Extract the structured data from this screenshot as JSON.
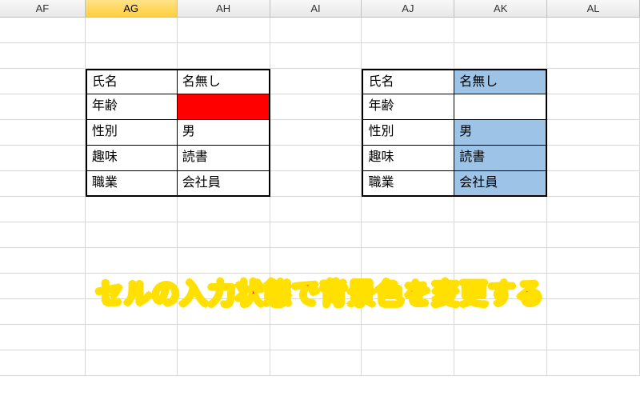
{
  "columns": {
    "AF": "AF",
    "AG": "AG",
    "AH": "AH",
    "AI": "AI",
    "AJ": "AJ",
    "AK": "AK",
    "AL": "AL"
  },
  "activeColumn": "AG",
  "table1": {
    "rows": [
      {
        "label": "氏名",
        "value": "名無し"
      },
      {
        "label": "年齢",
        "value": ""
      },
      {
        "label": "性別",
        "value": "男"
      },
      {
        "label": "趣味",
        "value": "読書"
      },
      {
        "label": "職業",
        "value": "会社員"
      }
    ],
    "emptyHighlightColor": "#ff0000"
  },
  "table2": {
    "rows": [
      {
        "label": "氏名",
        "value": "名無し"
      },
      {
        "label": "年齢",
        "value": ""
      },
      {
        "label": "性別",
        "value": "男"
      },
      {
        "label": "趣味",
        "value": "読書"
      },
      {
        "label": "職業",
        "value": "会社員"
      }
    ],
    "filledHighlightColor": "#9dc3e6"
  },
  "caption": "セルの入力状態で背景色を変更する"
}
